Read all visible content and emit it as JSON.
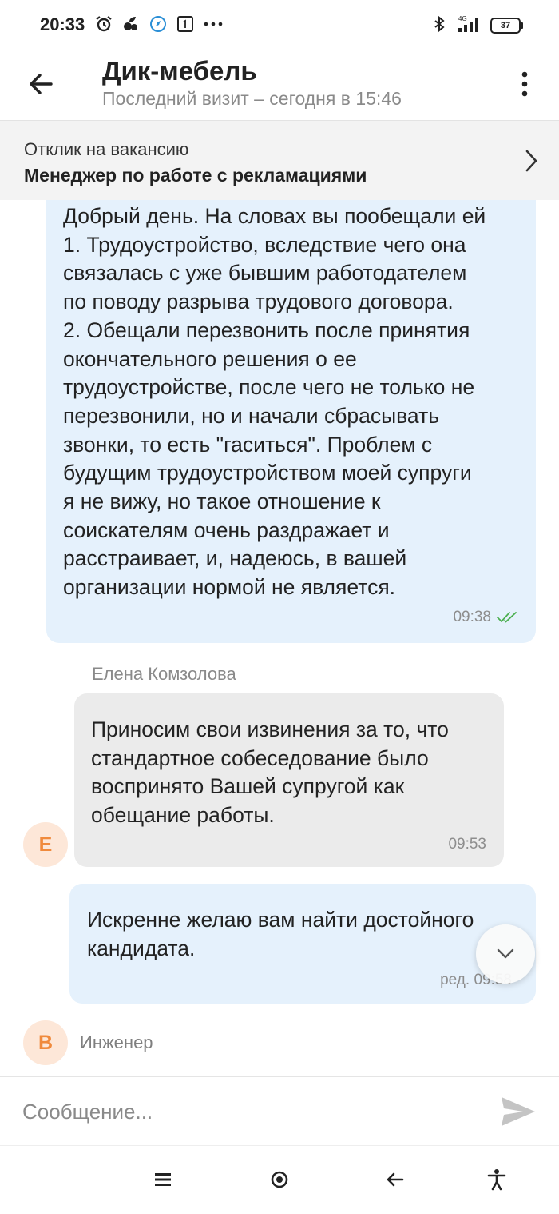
{
  "status_bar": {
    "time": "20:33",
    "battery": "37",
    "network": "4G"
  },
  "header": {
    "title": "Дик-мебель",
    "subtitle": "Последний визит – сегодня в 15:46"
  },
  "vacancy": {
    "caption": "Отклик на вакансию",
    "title": "Менеджер по работе с рекламациями"
  },
  "messages": [
    {
      "lines": [
        "Добрый день. На словах вы пообещали ей",
        "1. Трудоустройство, вследствие чего она",
        "связалась с уже бывшим работодателем",
        "по поводу разрыва трудового договора.",
        "2. Обещали перезвонить после принятия",
        "окончательного решения о ее",
        "трудоустройстве, после чего не только не",
        "перезвонили, но и начали сбрасывать",
        "звонки, то есть \"гаситься\". Проблем с",
        "будущим трудоустройством моей супруги",
        "я не вижу, но такое отношение к",
        "соискателям очень раздражает и",
        "расстраивает, и, надеюсь, в вашей",
        "организации нормой не является."
      ],
      "time": "09:38"
    },
    {
      "sender": "Елена Комзолова",
      "avatar_letter": "Е",
      "lines": [
        "Приносим свои извинения за то, что",
        "стандартное собеседование было",
        "воспринято Вашей супругой как",
        "обещание работы."
      ],
      "time": "09:53"
    },
    {
      "lines": [
        "Искренне желаю вам найти достойного",
        "кандидата."
      ],
      "time": "ред. 09:58"
    }
  ],
  "reply_context": {
    "avatar_letter": "В",
    "name": "Инженер"
  },
  "composer": {
    "placeholder": "Сообщение..."
  },
  "colors": {
    "outgoing_bubble": "#e5f1fc",
    "incoming_bubble": "#ebebeb",
    "read_check": "#4caf50",
    "avatar_bg": "#fde7d8",
    "avatar_fg": "#f08a3c"
  }
}
